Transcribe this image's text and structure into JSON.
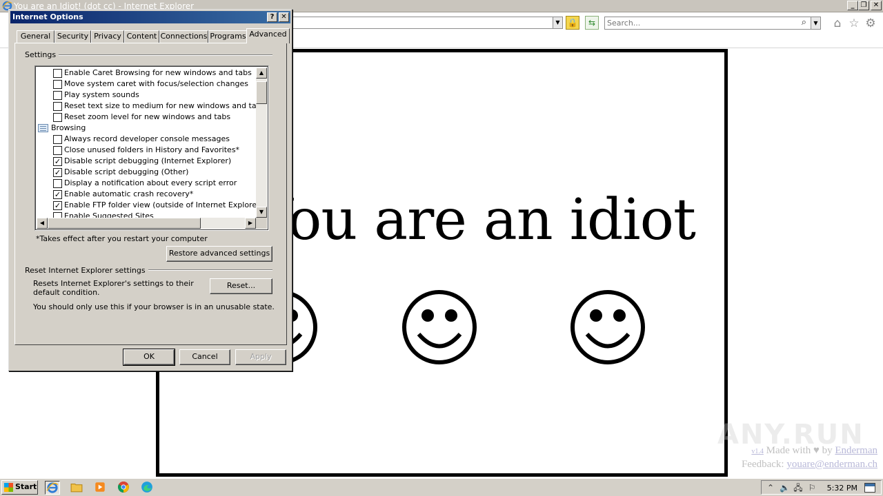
{
  "browser": {
    "window_title": "You are an Idiot! (dot cc) - Internet Explorer",
    "search_placeholder": "Search...",
    "minimize": "_",
    "restore": "❐",
    "close": "✕"
  },
  "page": {
    "headline": "You are an idiot",
    "credit_version": "v1.4",
    "credit_made_with": " Made with ♥ by ",
    "credit_author": "Enderman",
    "credit_feedback_label": "Feedback: ",
    "credit_feedback_email": "youare@enderman.ch",
    "watermark": "ANY.RUN"
  },
  "dialog": {
    "title": "Internet Options",
    "help_button": "?",
    "close_button": "✕",
    "tabs": [
      {
        "label": "General"
      },
      {
        "label": "Security"
      },
      {
        "label": "Privacy"
      },
      {
        "label": "Content"
      },
      {
        "label": "Connections"
      },
      {
        "label": "Programs"
      },
      {
        "label": "Advanced",
        "active": true
      }
    ],
    "settings_group_label": "Settings",
    "settings_items": [
      {
        "label": "Enable Caret Browsing for new windows and tabs",
        "checked": false
      },
      {
        "label": "Move system caret with focus/selection changes",
        "checked": false
      },
      {
        "label": "Play system sounds",
        "checked": false
      },
      {
        "label": "Reset text size to medium for new windows and tabs",
        "checked": false
      },
      {
        "label": "Reset zoom level for new windows and tabs",
        "checked": false
      },
      {
        "label": "Browsing",
        "category": true
      },
      {
        "label": "Always record developer console messages",
        "checked": false
      },
      {
        "label": "Close unused folders in History and Favorites*",
        "checked": false
      },
      {
        "label": "Disable script debugging (Internet Explorer)",
        "checked": true
      },
      {
        "label": "Disable script debugging (Other)",
        "checked": true
      },
      {
        "label": "Display a notification about every script error",
        "checked": false
      },
      {
        "label": "Enable automatic crash recovery*",
        "checked": true
      },
      {
        "label": "Enable FTP folder view (outside of Internet Explorer)",
        "checked": true
      },
      {
        "label": "Enable Suggested Sites",
        "checked": false
      }
    ],
    "restart_note": "*Takes effect after you restart your computer",
    "restore_button": "Restore advanced settings",
    "reset_group_label": "Reset Internet Explorer settings",
    "reset_description": "Resets Internet Explorer's settings to their default condition.",
    "reset_button": "Reset...",
    "reset_warning": "You should only use this if your browser is in an unusable state.",
    "ok_button": "OK",
    "cancel_button": "Cancel",
    "apply_button": "Apply"
  },
  "taskbar": {
    "start_label": "Start",
    "clock": "5:32 PM",
    "pinned": [
      "internet-explorer-icon",
      "folder-icon",
      "media-player-icon",
      "chrome-icon",
      "edge-icon"
    ]
  },
  "colors": {
    "dialog_face": "#d4d0c8",
    "dialog_title_start": "#0a246a",
    "dialog_title_end": "#3a6ea5"
  }
}
